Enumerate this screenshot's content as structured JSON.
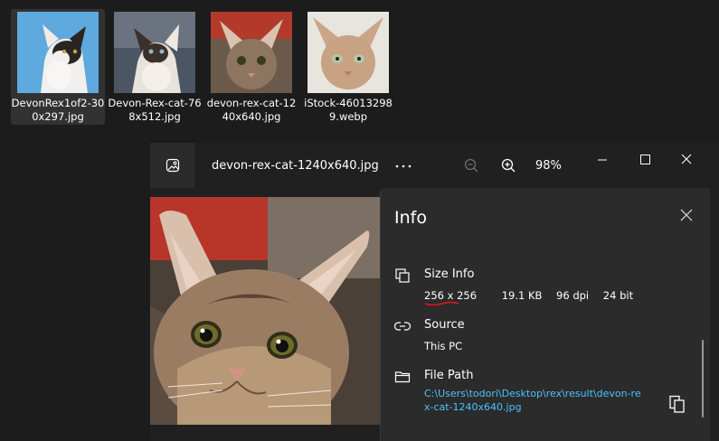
{
  "explorer": {
    "thumbnails": [
      {
        "label": "DevonRex1of2-300x297.jpg",
        "selected": true
      },
      {
        "label": "Devon-Rex-cat-768x512.jpg",
        "selected": false
      },
      {
        "label": "devon-rex-cat-1240x640.jpg",
        "selected": false
      },
      {
        "label": "iStock-460132989.webp",
        "selected": false
      }
    ]
  },
  "viewer": {
    "file_name": "devon-rex-cat-1240x640.jpg",
    "more_icon": "more-icon",
    "zoom_out_icon": "zoom-out-icon",
    "zoom_in_icon": "zoom-in-icon",
    "zoom_level": "98%",
    "window_controls": [
      "minimize-icon",
      "maximize-icon",
      "close-icon"
    ]
  },
  "info": {
    "title": "Info",
    "size_section": {
      "heading": "Size Info",
      "dimensions": "256 x 256",
      "file_size": "19.1 KB",
      "dpi": "96 dpi",
      "bit_depth": "24 bit",
      "annotation_color": "#e81123"
    },
    "source_section": {
      "heading": "Source",
      "value": "This PC"
    },
    "path_section": {
      "heading": "File Path",
      "value": "C:\\Users\\todori\\Desktop\\rex\\result\\devon-rex-cat-1240x640.jpg"
    }
  },
  "colors": {
    "background": "#1c1c1c",
    "panel": "#2b2b2b",
    "link": "#4cc2ff",
    "selection": "#323232"
  }
}
